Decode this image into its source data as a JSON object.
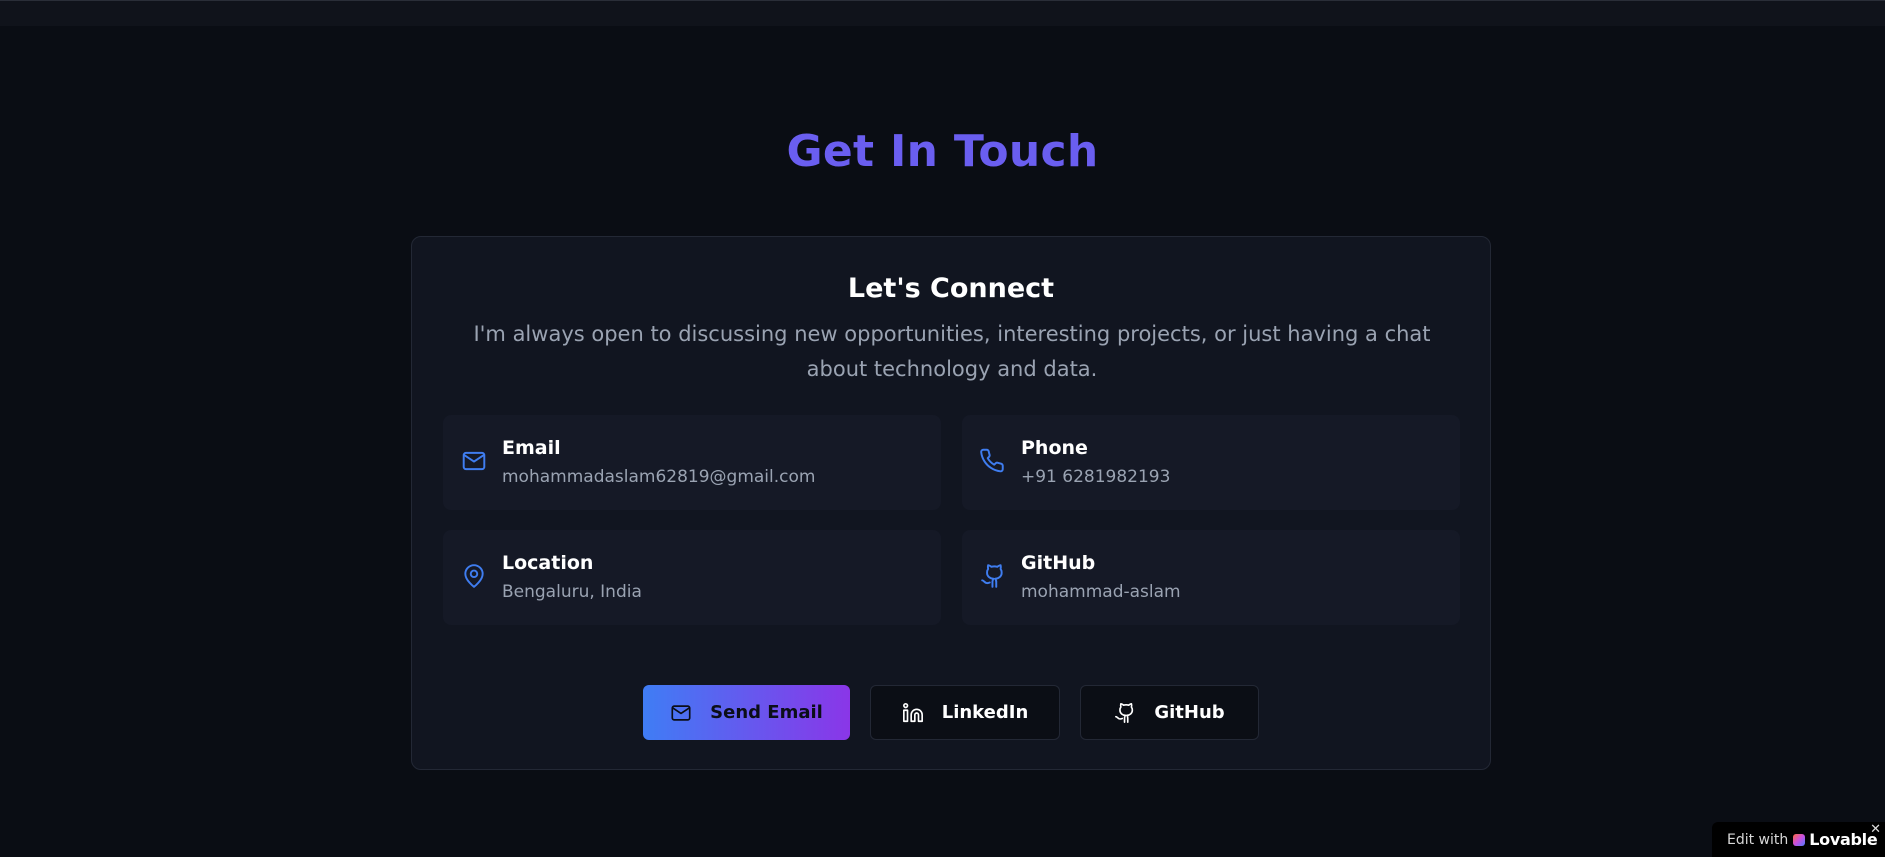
{
  "section": {
    "title": "Get In Touch"
  },
  "card": {
    "title": "Let's Connect",
    "description": "I'm always open to discussing new opportunities, interesting projects, or just having a chat about technology and data."
  },
  "contacts": [
    {
      "icon": "mail-icon",
      "label": "Email",
      "value": "mohammadaslam62819@gmail.com"
    },
    {
      "icon": "phone-icon",
      "label": "Phone",
      "value": "+91 6281982193"
    },
    {
      "icon": "map-pin-icon",
      "label": "Location",
      "value": "Bengaluru, India"
    },
    {
      "icon": "github-icon",
      "label": "GitHub",
      "value": "mohammad-aslam"
    }
  ],
  "buttons": {
    "send_email": "Send Email",
    "linkedin": "LinkedIn",
    "github": "GitHub"
  },
  "badge": {
    "edit_with": "Edit with",
    "brand": "Lovable",
    "close": "✕"
  },
  "colors": {
    "background": "#0a0d14",
    "card": "#111520",
    "accent_heading": "#6a5ef0",
    "icon_blue": "#3f7df0",
    "gradient_start": "#3f7df5",
    "gradient_end": "#8a36e8"
  }
}
